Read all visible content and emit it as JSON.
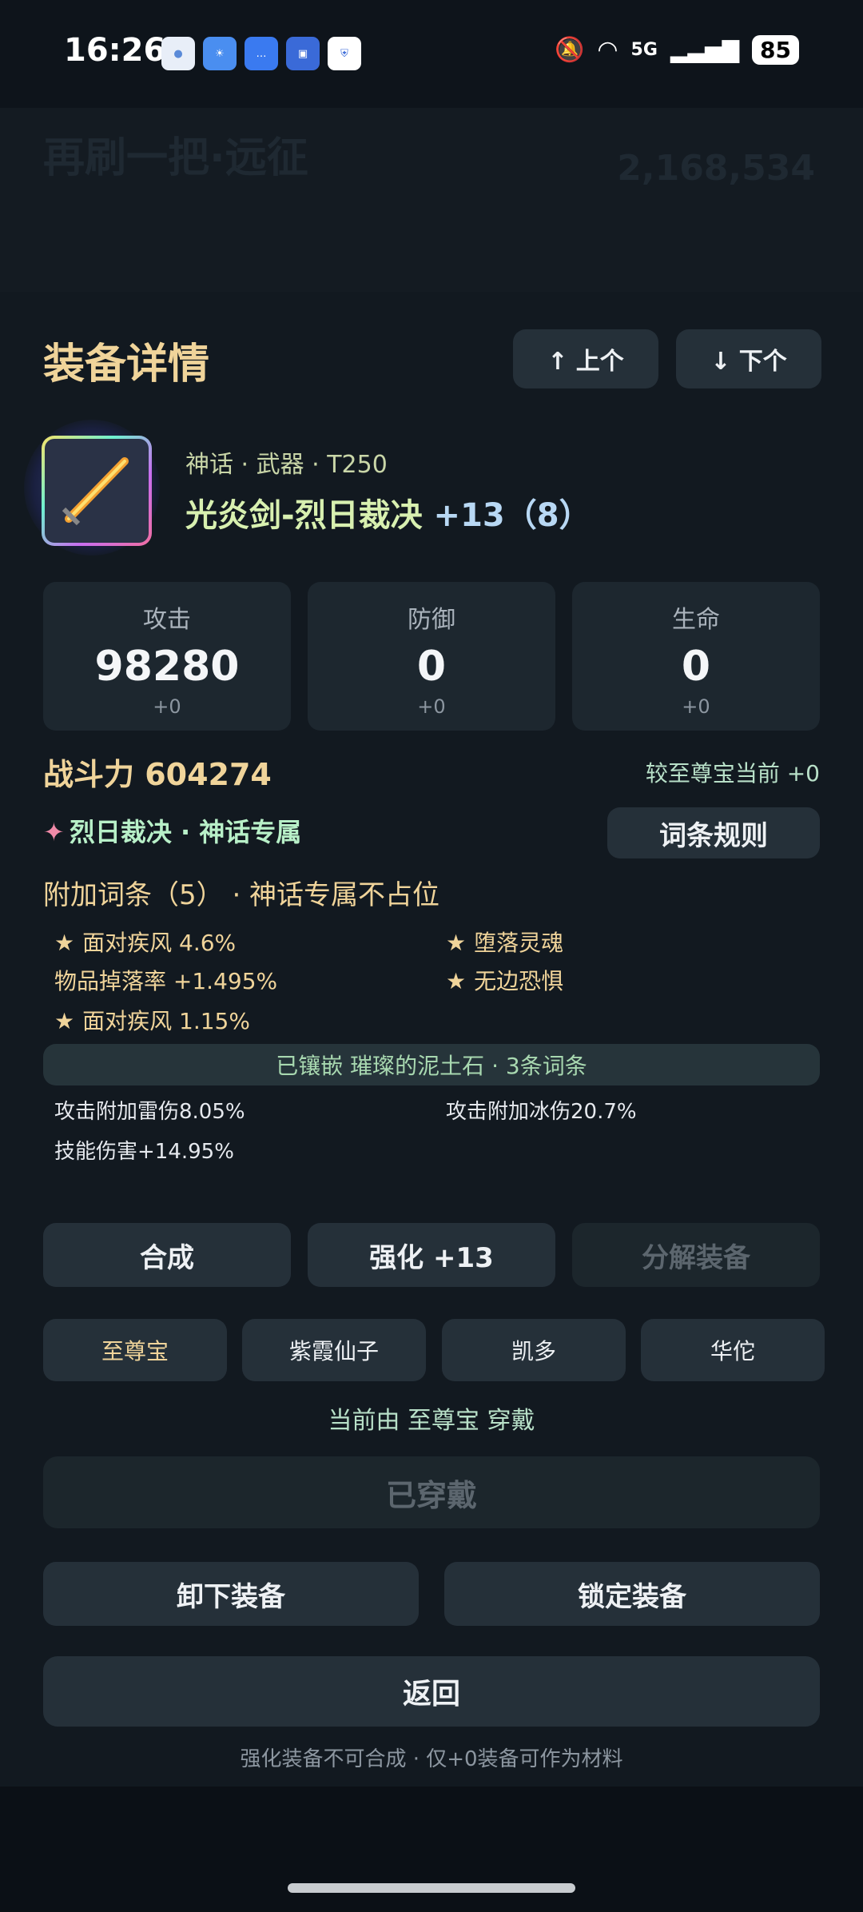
{
  "status_bar": {
    "time": "16:26",
    "network": "5G",
    "battery": "85"
  },
  "background": {
    "title": "再刷一把·远征",
    "number": "2,168,534"
  },
  "panel": {
    "title": "装备详情",
    "prev_label": "↑ 上个",
    "next_label": "↓ 下个"
  },
  "item": {
    "meta": "神话 · 武器 · T250",
    "name": "光炎剑-烈日裁决",
    "enhance": "+13（8）"
  },
  "stats": [
    {
      "label": "攻击",
      "value": "98280",
      "delta": "+0"
    },
    {
      "label": "防御",
      "value": "0",
      "delta": "+0"
    },
    {
      "label": "生命",
      "value": "0",
      "delta": "+0"
    }
  ],
  "power": {
    "label": "战斗力 604274",
    "compare": "较至尊宝当前 +0"
  },
  "exclusive": {
    "star": "✦",
    "text": "烈日裁决 · 神话专属",
    "rule_button": "词条规则"
  },
  "affixes": {
    "title": "附加词条（5） · 神话专属不占位",
    "items": [
      {
        "text": "面对疾风 4.6%",
        "starred": true
      },
      {
        "text": "堕落灵魂",
        "starred": true
      },
      {
        "text": "物品掉落率 +1.495%",
        "starred": false
      },
      {
        "text": "无边恐惧",
        "starred": true
      },
      {
        "text": "面对疾风 1.15%",
        "starred": true
      }
    ]
  },
  "socket": {
    "label": "已镶嵌 璀璨的泥土石 · 3条词条",
    "affixes": [
      "攻击附加雷伤8.05%",
      "攻击附加冰伤20.7%",
      "技能伤害+14.95%"
    ]
  },
  "actions": {
    "synthesize": "合成",
    "enhance": "强化 +13",
    "dismantle": "分解装备"
  },
  "wearers": [
    "至尊宝",
    "紫霞仙子",
    "凯多",
    "华佗"
  ],
  "worn_by": "当前由 至尊宝 穿戴",
  "worn_button": "已穿戴",
  "unequip": "卸下装备",
  "lock": "锁定装备",
  "back": "返回",
  "footer_note": "强化装备不可合成 · 仅+0装备可作为材料"
}
